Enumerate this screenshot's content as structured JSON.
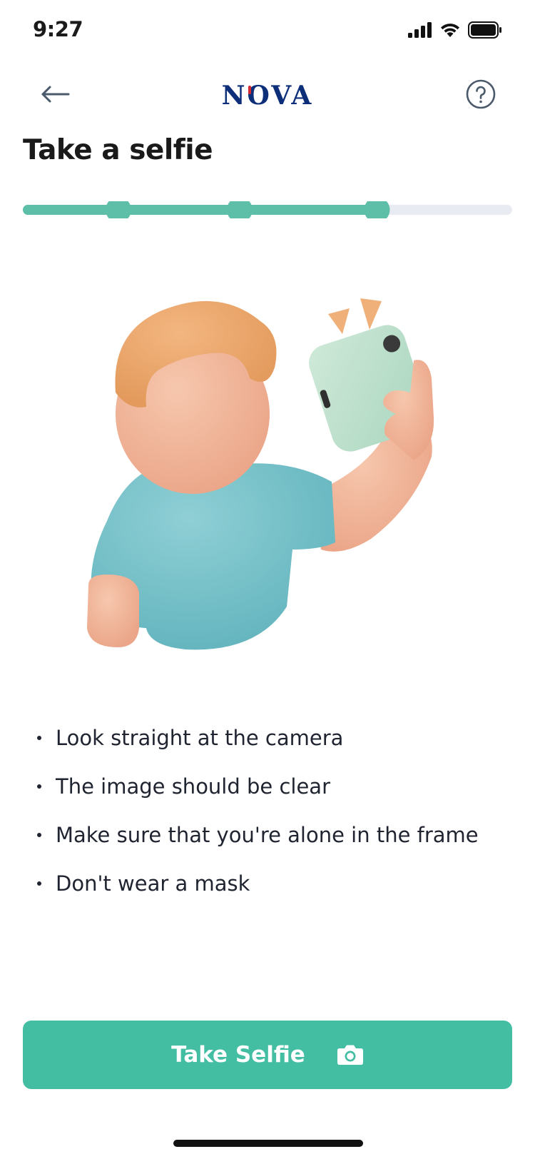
{
  "status_bar": {
    "time": "9:27"
  },
  "nav": {
    "back_icon": "arrow-left-icon",
    "logo_text": "NOVA",
    "help_icon": "question-circle-icon"
  },
  "page": {
    "title": "Take a selfie"
  },
  "progress": {
    "steps_total": 4,
    "steps_completed": 3,
    "fraction": 0.75,
    "active_color": "#5dbfa8",
    "inactive_color": "#e9ebf2"
  },
  "tips": [
    "Look straight at the camera",
    "The image should be clear",
    "Make sure that you're alone in the frame",
    "Don't wear a mask"
  ],
  "actions": {
    "primary_label": "Take Selfie",
    "primary_icon": "camera-icon",
    "primary_color": "#43bea3"
  },
  "colors": {
    "brand_navy": "#0d2f7a",
    "brand_red": "#d6282f",
    "icon_gray": "#4b5a6b"
  }
}
